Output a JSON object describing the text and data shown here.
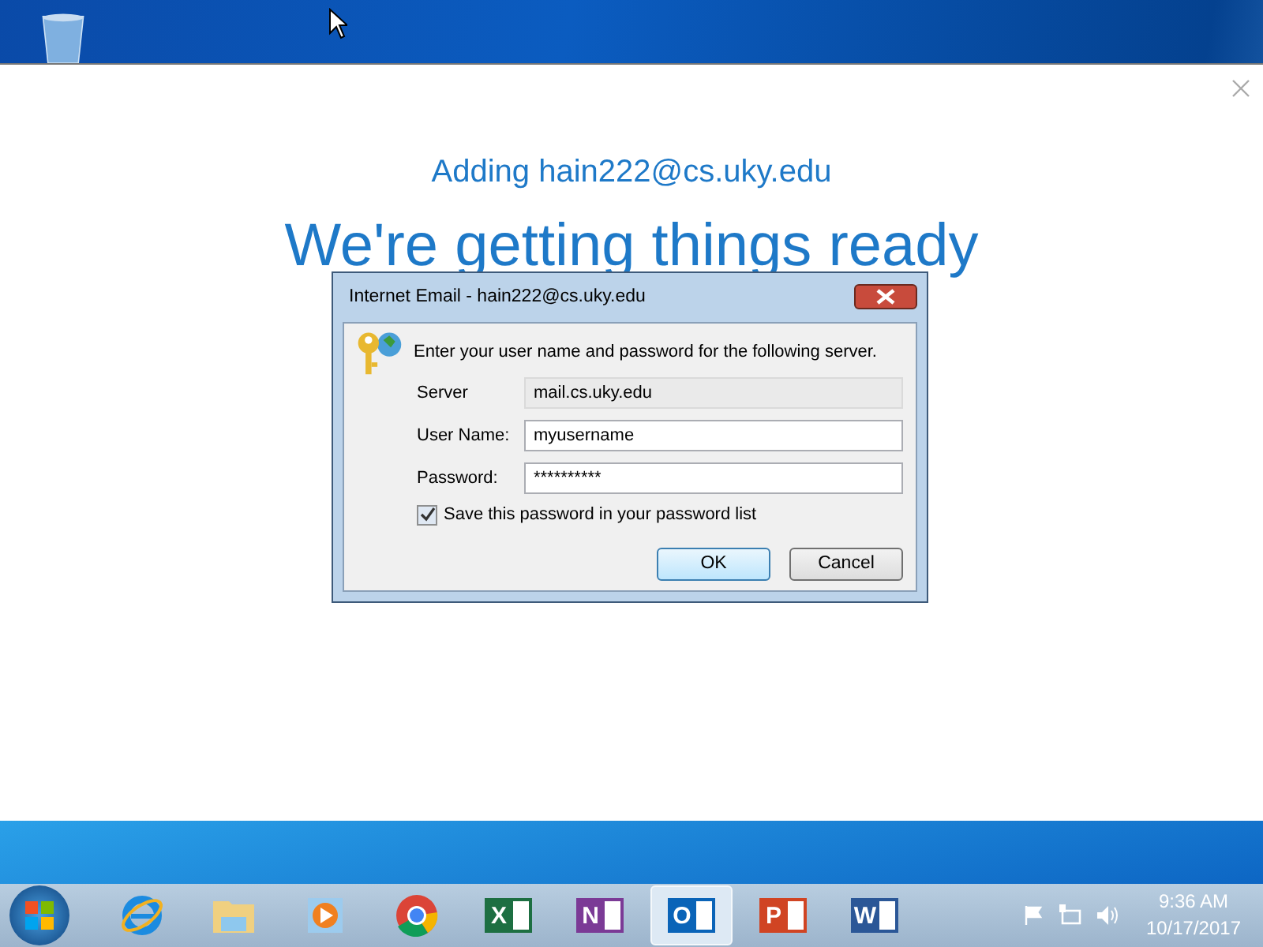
{
  "setup": {
    "subtitle": "Adding hain222@cs.uky.edu",
    "heading": "We're getting things ready"
  },
  "dialog": {
    "title": "Internet Email - hain222@cs.uky.edu",
    "prompt": "Enter your user name and password for the following server.",
    "fields": [
      {
        "label": "Server",
        "value": "mail.cs.uky.edu",
        "disabled": true
      },
      {
        "label": "User Name:",
        "value": "myusername",
        "disabled": false
      },
      {
        "label": "Password:",
        "value": "**********",
        "disabled": false
      }
    ],
    "save_password": {
      "label": "Save this password in your password list",
      "checked": true
    },
    "buttons": [
      {
        "label": "OK",
        "default": true
      },
      {
        "label": "Cancel",
        "default": false
      }
    ]
  },
  "taskbar": {
    "apps": [
      {
        "kind": "ie",
        "selected": false
      },
      {
        "kind": "explorer",
        "selected": false
      },
      {
        "kind": "media",
        "selected": false
      },
      {
        "kind": "chrome",
        "selected": false
      },
      {
        "kind": "office",
        "glyph": "X",
        "color": "#1d6f42",
        "selected": false
      },
      {
        "kind": "office",
        "glyph": "N",
        "color": "#7b3a96",
        "selected": false
      },
      {
        "kind": "office",
        "glyph": "O",
        "color": "#0a64b8",
        "selected": true
      },
      {
        "kind": "office",
        "glyph": "P",
        "color": "#d04423",
        "selected": false
      },
      {
        "kind": "office",
        "glyph": "W",
        "color": "#2b5797",
        "selected": false
      }
    ],
    "time": "9:36 AM",
    "date": "10/17/2017"
  }
}
